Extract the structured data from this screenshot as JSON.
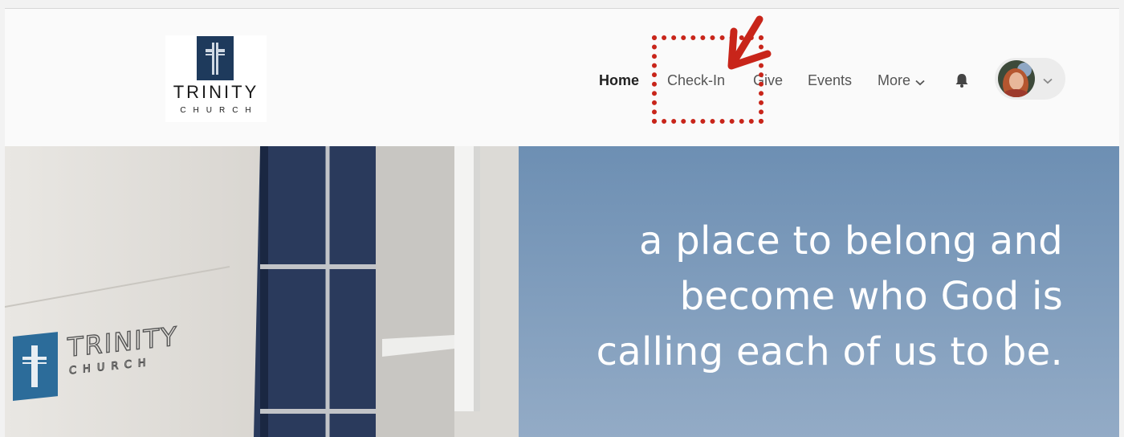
{
  "logo": {
    "word": "TRINITY",
    "sub": "CHURCH"
  },
  "nav": {
    "items": [
      {
        "label": "Home"
      },
      {
        "label": "Check-In"
      },
      {
        "label": "Give"
      },
      {
        "label": "Events"
      },
      {
        "label": "More"
      }
    ],
    "icons": {
      "more": "chevron-down-icon",
      "notifications": "bell-icon",
      "user_menu": "chevron-down-icon"
    }
  },
  "hero": {
    "lines": [
      "a place to belong and",
      "become who God is",
      "calling each of us to be."
    ],
    "sign_word": "TRINITY",
    "sign_sub": "CHURCH"
  },
  "colors": {
    "brand_navy": "#1e3a5c",
    "annotation_red": "#c8251a",
    "sky_blue": "#7d9ab8"
  }
}
